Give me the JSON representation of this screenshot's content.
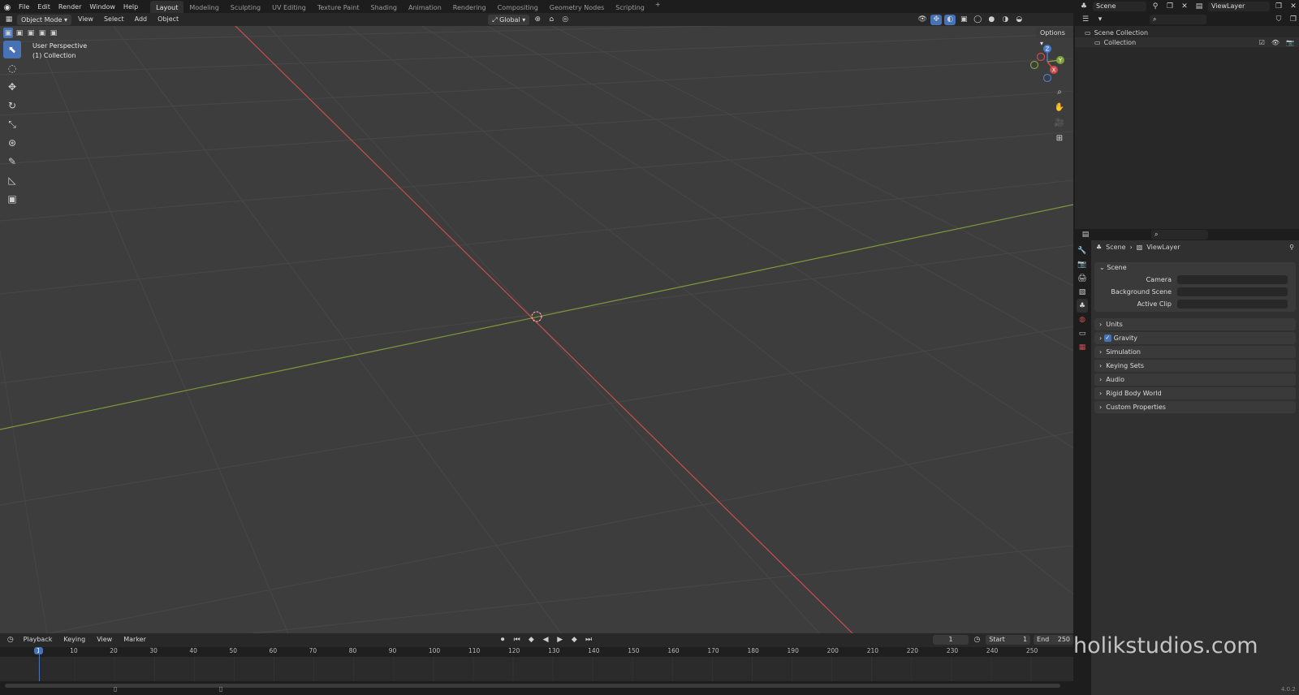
{
  "app": {
    "version": "4.0.2"
  },
  "menubar": {
    "logo_icon": "blender-logo-icon",
    "menus": [
      "File",
      "Edit",
      "Render",
      "Window",
      "Help"
    ],
    "workspaces": [
      "Layout",
      "Modeling",
      "Sculpting",
      "UV Editing",
      "Texture Paint",
      "Shading",
      "Animation",
      "Rendering",
      "Compositing",
      "Geometry Nodes",
      "Scripting"
    ],
    "active_workspace": "Layout",
    "add_workspace": "+"
  },
  "top_right": {
    "scene": "Scene",
    "view_layer": "ViewLayer"
  },
  "viewport_header": {
    "mode": "Object Mode",
    "menus": [
      "View",
      "Select",
      "Add",
      "Object"
    ],
    "orientation": "Global",
    "options": "Options"
  },
  "viewport": {
    "perspective": "User Perspective",
    "collection": "(1) Collection",
    "axes": {
      "x": "X",
      "y": "Y",
      "z": "Z"
    },
    "colors": {
      "bg": "#3d3d3d",
      "x_axis": "#c94f4f",
      "y_axis": "#7d9a3a",
      "active": "#4772b3"
    }
  },
  "outliner": {
    "items": [
      {
        "label": "Scene Collection"
      },
      {
        "label": "Collection"
      }
    ]
  },
  "properties": {
    "breadcrumb": {
      "scene": "Scene",
      "view_layer": "ViewLayer"
    },
    "section": "Scene",
    "fields": [
      {
        "label": "Camera"
      },
      {
        "label": "Background Scene"
      },
      {
        "label": "Active Clip"
      }
    ],
    "panels": [
      "Units",
      "Gravity",
      "Simulation",
      "Keying Sets",
      "Audio",
      "Rigid Body World",
      "Custom Properties"
    ],
    "gravity_checked": true
  },
  "timeline": {
    "menus": [
      "Playback",
      "Keying",
      "View",
      "Marker"
    ],
    "current_frame": "1",
    "start_label": "Start",
    "start": "1",
    "end_label": "End",
    "end": "250",
    "ticks": [
      "1",
      "10",
      "20",
      "30",
      "40",
      "50",
      "60",
      "70",
      "80",
      "90",
      "100",
      "110",
      "120",
      "130",
      "140",
      "150",
      "160",
      "170",
      "180",
      "190",
      "200",
      "210",
      "220",
      "230",
      "240",
      "250"
    ]
  },
  "watermark": "holikstudios.com"
}
